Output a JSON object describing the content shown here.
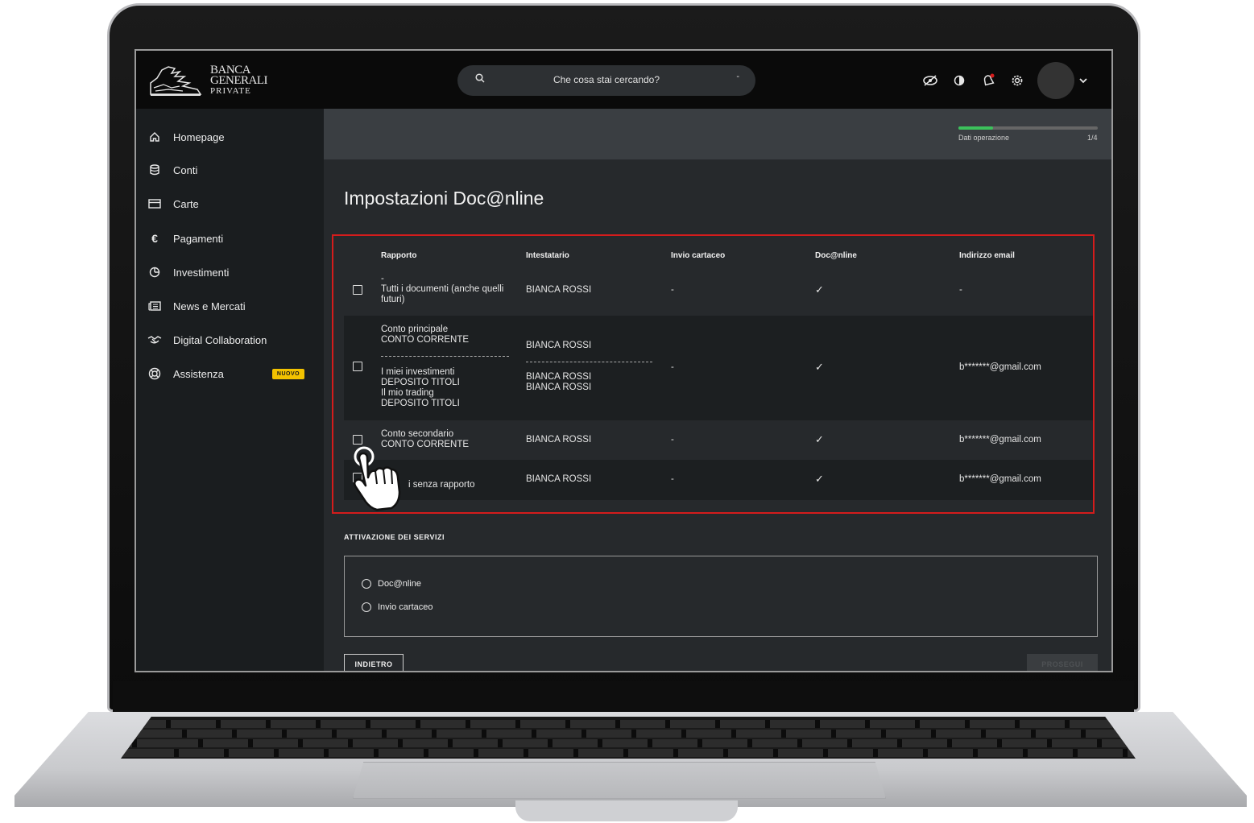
{
  "brand": {
    "line1": "BANCA",
    "line2": "GENERALI",
    "line3": "PRIVATE"
  },
  "search": {
    "placeholder": "Che cosa stai cercando?"
  },
  "top_icons": [
    "eye-off-icon",
    "contrast-icon",
    "bell-icon",
    "gear-icon"
  ],
  "sidebar": {
    "items": [
      {
        "label": "Homepage",
        "icon": "home-icon"
      },
      {
        "label": "Conti",
        "icon": "database-icon"
      },
      {
        "label": "Carte",
        "icon": "card-icon"
      },
      {
        "label": "Pagamenti",
        "icon": "euro-icon"
      },
      {
        "label": "Investimenti",
        "icon": "pie-chart-icon"
      },
      {
        "label": "News e Mercati",
        "icon": "newspaper-icon"
      },
      {
        "label": "Digital Collaboration",
        "icon": "handshake-icon"
      },
      {
        "label": "Assistenza",
        "icon": "lifebuoy-icon",
        "badge": "NUOVO"
      }
    ]
  },
  "progress": {
    "label": "Dati operazione",
    "step": "1/4",
    "fraction": 0.25,
    "color": "#3cc15b"
  },
  "page": {
    "title": "Impostazioni Doc@nline"
  },
  "table": {
    "headers": {
      "rapporto": "Rapporto",
      "intestatario": "Intestatario",
      "invio": "Invio cartaceo",
      "doconline": "Doc@nline",
      "email": "Indirizzo email"
    },
    "rows": [
      {
        "rapporto_a": "-",
        "rapporto_b": "Tutti i documenti (anche quelli",
        "rapporto_c": "futuri)",
        "intestatario": "BIANCA ROSSI",
        "invio": "-",
        "doconline": "✓",
        "email": "-"
      },
      {
        "rapporto_a": "Conto principale",
        "rapporto_b": "CONTO CORRENTE",
        "rapporto_c": "I miei investimenti",
        "rapporto_d": "DEPOSITO TITOLI",
        "rapporto_e": "Il mio trading",
        "rapporto_f": "DEPOSITO TITOLI",
        "intestatario_a": "BIANCA ROSSI",
        "intestatario_b": "BIANCA ROSSI",
        "intestatario_c": "BIANCA ROSSI",
        "invio": "-",
        "doconline": "✓",
        "email": "b*******@gmail.com"
      },
      {
        "rapporto_a": "Conto secondario",
        "rapporto_b": "CONTO CORRENTE",
        "intestatario": "BIANCA ROSSI",
        "invio": "-",
        "doconline": "✓",
        "email": "b*******@gmail.com"
      },
      {
        "rapporto_a": "i senza rapporto",
        "intestatario": "BIANCA ROSSI",
        "invio": "-",
        "doconline": "✓",
        "email": "b*******@gmail.com"
      }
    ]
  },
  "services": {
    "title": "ATTIVAZIONE DEI SERVIZI",
    "options": [
      "Doc@nline",
      "Invio cartaceo"
    ]
  },
  "buttons": {
    "back": "INDIETRO",
    "next": "PROSEGUI"
  },
  "colors": {
    "highlight": "#d41c1c",
    "badge": "#f2c200"
  }
}
